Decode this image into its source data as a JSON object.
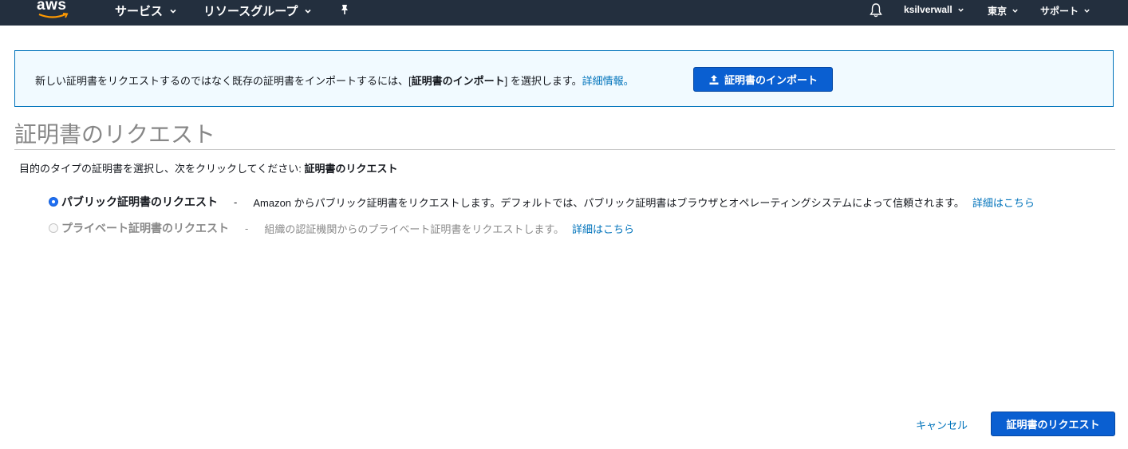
{
  "nav": {
    "logo_text": "aws",
    "services": "サービス",
    "resource_groups": "リソースグループ",
    "user": "ksilverwall",
    "region": "東京",
    "support": "サポート"
  },
  "info_banner": {
    "text_prefix": "新しい証明書をリクエストするのではなく既存の証明書をインポートするには、[",
    "text_bold": "証明書のインポート",
    "text_suffix": "] を選択します。",
    "link": "詳細情報。",
    "button_label": "証明書のインポート"
  },
  "page": {
    "title": "証明書のリクエスト",
    "instruction_prefix": "目的のタイプの証明書を選択し、次をクリックしてください: ",
    "instruction_bold": "証明書のリクエスト"
  },
  "options": [
    {
      "label": "パブリック証明書のリクエスト",
      "dash": "-",
      "description": "Amazon からパブリック証明書をリクエストします。デフォルトでは、パブリック証明書はブラウザとオペレーティングシステムによって信頼されます。",
      "link": "詳細はこちら",
      "selected": true,
      "enabled": true
    },
    {
      "label": "プライベート証明書のリクエスト",
      "dash": "-",
      "description": "組織の認証機関からのプライベート証明書をリクエストします。",
      "link": "詳細はこちら",
      "selected": false,
      "enabled": false
    }
  ],
  "footer": {
    "cancel": "キャンセル",
    "submit": "証明書のリクエスト"
  },
  "colors": {
    "nav_bg": "#232f3e",
    "primary": "#0a5fd1",
    "link": "#0073bb",
    "banner_bg": "#f1faff"
  }
}
